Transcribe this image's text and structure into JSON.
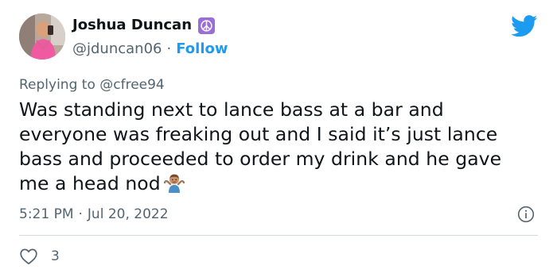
{
  "tweet": {
    "display_name": "Joshua Duncan",
    "handle": "@jduncan06",
    "separator": "·",
    "follow_label": "Follow",
    "replying_prefix": "Replying to ",
    "replying_to": "@cfree94",
    "text_lines": [
      "Was standing next to lance bass at a bar and",
      "everyone was freaking out and I said it’s just lance",
      "bass and proceeded to order my drink and he gave",
      "me a head nod"
    ],
    "time": "5:21 PM",
    "date": "Jul 20, 2022",
    "like_count": "3"
  },
  "icons": {
    "badge": "peace-symbol-icon",
    "logo": "twitter-bird-icon",
    "emoji": "person-shrugging-emoji",
    "info": "info-icon",
    "like": "heart-icon"
  },
  "colors": {
    "accent": "#1d9bf0",
    "secondary_text": "#536471",
    "primary_text": "#0f1419",
    "divider": "#cfd9de",
    "badge_purple": "#9b6dd6"
  }
}
